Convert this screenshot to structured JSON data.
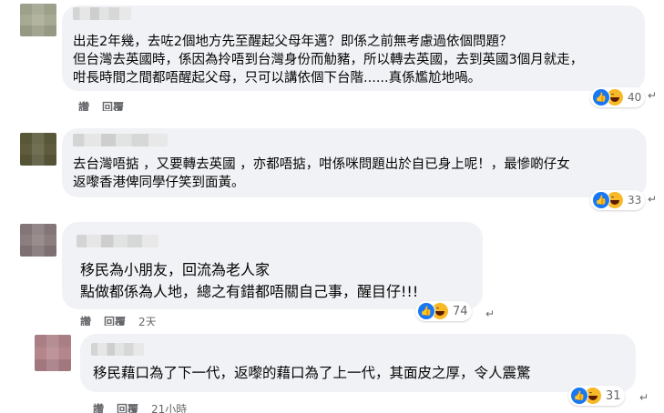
{
  "comments": [
    {
      "lines": [
        "出走2年幾，去咗2個地方先至醒起父母年邁？即係之前無考慮過依個問題？",
        "但台灣去英國時，係因為拎唔到台灣身份而觔豬，所以轉去英國，去到英國3個月就走，",
        "咁長時間之間都唔醒起父母，只可以講依個下台階......真係尷尬地喎。"
      ],
      "reaction_count": "40",
      "actions": {
        "like": "讚",
        "reply": "回覆",
        "time": ""
      }
    },
    {
      "lines": [
        "去台灣唔掂 ，又要轉去英國 ，亦都唔掂，咁係咪問題出於自已身上呢！，最慘啲仔女",
        "返嚟香港俾同學仔笑到面黃。"
      ],
      "reaction_count": "33",
      "actions": {
        "like": "",
        "reply": "",
        "time": ""
      }
    },
    {
      "lines": [
        "移民為小朋友，回流為老人家",
        "點做都係為人地，總之有錯都唔關自己事，醒目仔!!!"
      ],
      "reaction_count": "74",
      "actions": {
        "like": "讚",
        "reply": "回覆",
        "time": "2天"
      }
    },
    {
      "lines": [
        "移民藉口為了下一代，返嚟的藉口為了上一代，其面皮之厚，令人震驚"
      ],
      "reaction_count": "31",
      "actions": {
        "like": "讚",
        "reply": "回覆",
        "time": "21小時"
      }
    }
  ],
  "icons": {
    "like": "like-reaction-icon",
    "haha": "haha-reaction-icon",
    "return": "reply-return-icon"
  },
  "colors": {
    "bubble": "#f0f2f5",
    "like_blue": "#1877f2",
    "haha_yellow": "#f7b928",
    "meta_gray": "#65676b"
  }
}
